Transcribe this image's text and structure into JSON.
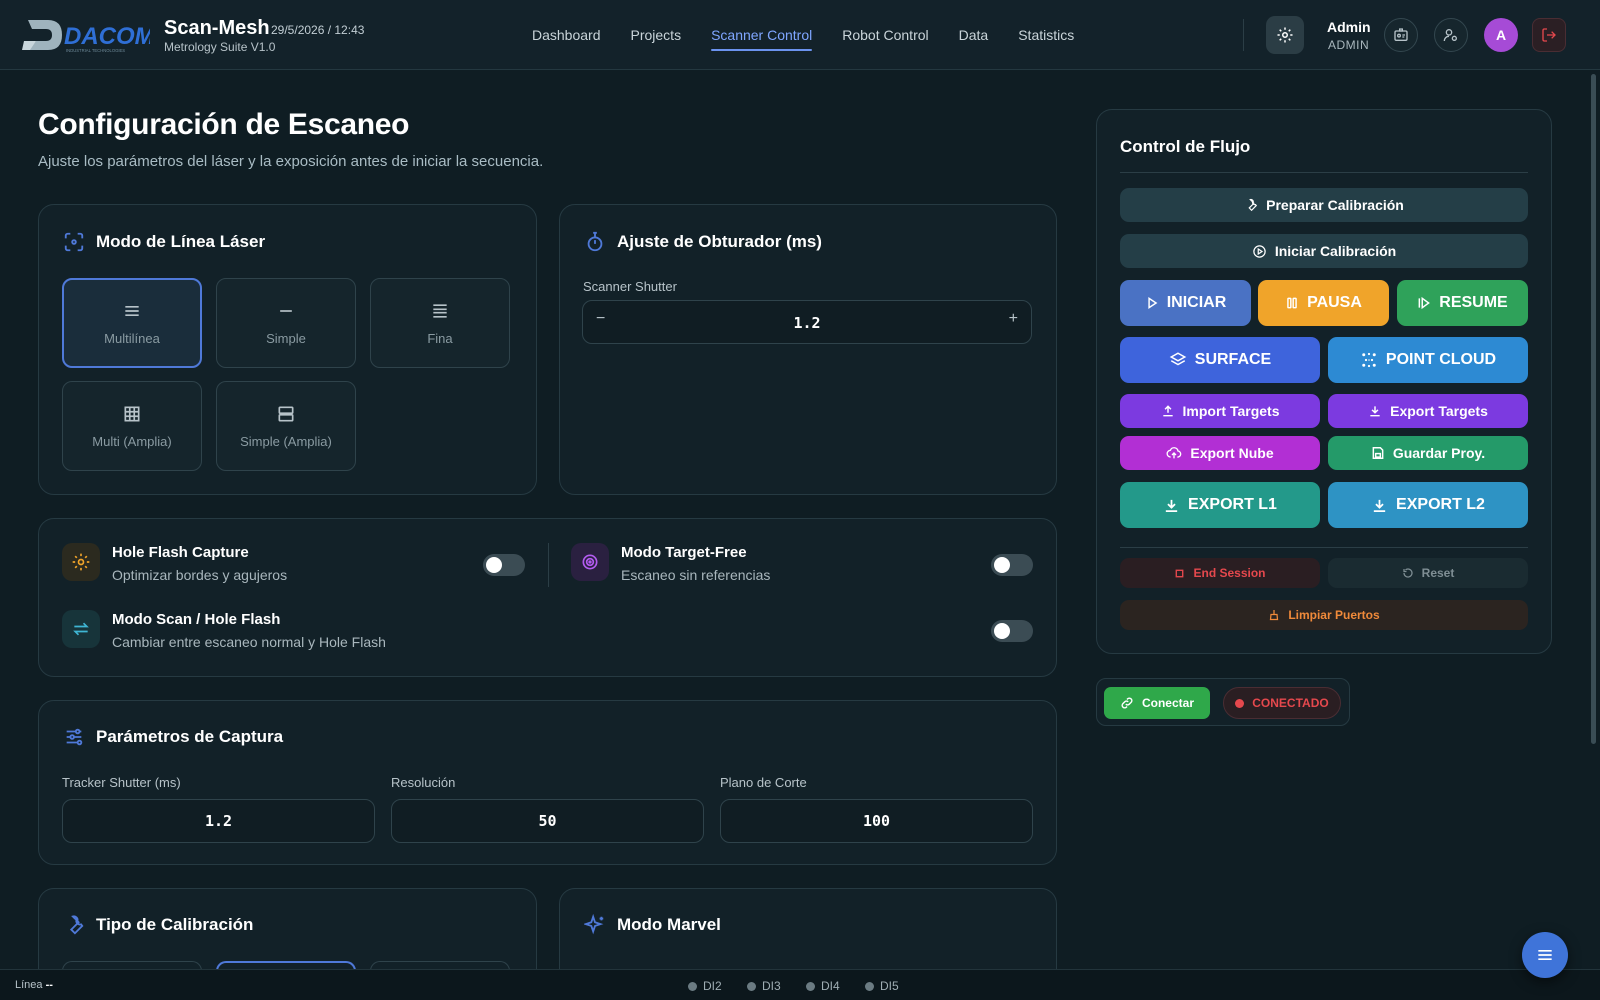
{
  "header": {
    "brand_title": "Scan-Mesh",
    "brand_datetime": "29/5/2026 / 12:43",
    "brand_subtitle": "Metrology Suite V1.0",
    "logo_text": "DACOM",
    "logo_tagline": "INDUSTRIAL TECHNOLOGIES",
    "nav": [
      "Dashboard",
      "Projects",
      "Scanner Control",
      "Robot Control",
      "Data",
      "Statistics"
    ],
    "active_nav": "Scanner Control",
    "user_name": "Admin",
    "user_role": "ADMIN",
    "avatar_initial": "A"
  },
  "page": {
    "title": "Configuración de Escaneo",
    "subtitle": "Ajuste los parámetros del láser y la exposición antes de iniciar la secuencia."
  },
  "laser_mode": {
    "title": "Modo de Línea Láser",
    "options": [
      "Multilínea",
      "Simple",
      "Fina",
      "Multi (Amplia)",
      "Simple (Amplia)"
    ],
    "selected": "Multilínea"
  },
  "shutter": {
    "title": "Ajuste de Obturador (ms)",
    "label": "Scanner Shutter",
    "value": "1.2",
    "minus": "−",
    "plus": "+"
  },
  "options": {
    "hole_flash": {
      "title": "Hole Flash Capture",
      "desc": "Optimizar bordes y agujeros",
      "enabled": false
    },
    "target_free": {
      "title": "Modo Target-Free",
      "desc": "Escaneo sin referencias",
      "enabled": false
    },
    "scan_hole": {
      "title": "Modo Scan / Hole Flash",
      "desc": "Cambiar entre escaneo normal y Hole Flash",
      "enabled": false
    }
  },
  "capture": {
    "title": "Parámetros de Captura",
    "fields": [
      {
        "label": "Tracker Shutter (ms)",
        "value": "1.2"
      },
      {
        "label": "Resolución",
        "value": "50"
      },
      {
        "label": "Plano de Corte",
        "value": "100"
      }
    ]
  },
  "calibration": {
    "title": "Tipo de Calibración"
  },
  "marvel": {
    "title": "Modo Marvel"
  },
  "flow": {
    "title": "Control de Flujo",
    "prepare": "Preparar Calibración",
    "start_cal": "Iniciar Calibración",
    "iniciar": "INICIAR",
    "pausa": "PAUSA",
    "resume": "RESUME",
    "surface": "SURFACE",
    "point_cloud": "POINT CLOUD",
    "import_targets": "Import Targets",
    "export_targets": "Export Targets",
    "export_nube": "Export Nube",
    "guardar": "Guardar Proy.",
    "export_l1": "EXPORT L1",
    "export_l2": "EXPORT L2",
    "end_session": "End Session",
    "reset": "Reset",
    "limpiar": "Limpiar Puertos"
  },
  "connection": {
    "connect": "Conectar",
    "status": "CONECTADO"
  },
  "footer": {
    "line_label": "Línea",
    "line_value": "--",
    "di": [
      "DI2",
      "DI3",
      "DI4",
      "DI5"
    ]
  },
  "colors": {
    "background": "#0f1d23",
    "accent_blue": "#4f79d8",
    "iniciar": "#4a72c4",
    "pausa": "#f0a42a",
    "resume": "#2fa25a",
    "surface": "#3e64dc",
    "point_cloud": "#2d8ad3",
    "targets": "#7c3ae0",
    "export_nube": "#b22fd4",
    "guardar": "#249a69",
    "export_l1": "#23998a",
    "export_l2": "#2e93c4",
    "status_red": "#e5484d"
  }
}
